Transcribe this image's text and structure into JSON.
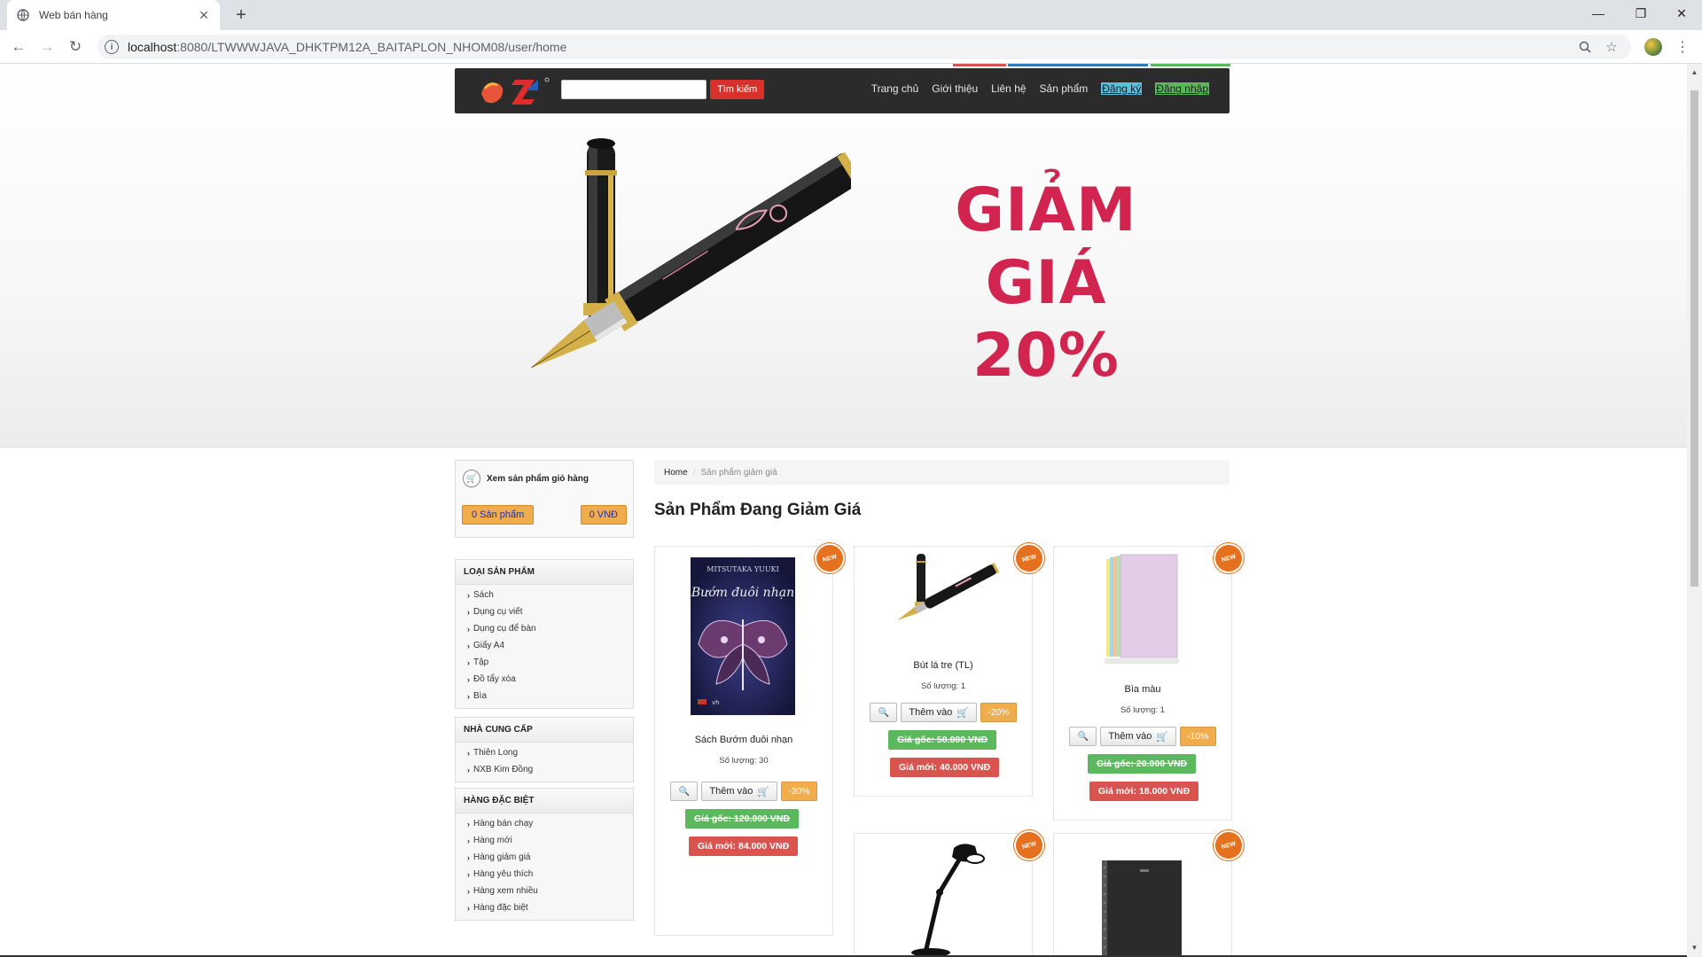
{
  "browser": {
    "tab_title": "Web bán hàng",
    "url_host": "localhost",
    "url_path": ":8080/LTWWWJAVA_DHKTPM12A_BAITAPLON_NHOM08/user/home"
  },
  "nav": {
    "search_button": "Tìm kiếm",
    "links": [
      "Trang chủ",
      "Giới thiệu",
      "Liên hệ",
      "Sản phẩm",
      "Đăng ký",
      "Đăng nhập"
    ]
  },
  "banner": {
    "line1": "GIẢM",
    "line2": "GIÁ",
    "line3": "20%"
  },
  "cart": {
    "title": "Xem sản phẩm giỏ hàng",
    "count": "0 Sản phẩm",
    "total": "0 VNĐ"
  },
  "sidebar": {
    "categories_title": "LOẠI SẢN PHẨM",
    "categories": [
      "Sách",
      "Dụng cụ viết",
      "Dụng cụ để bàn",
      "Giấy A4",
      "Tập",
      "Đồ tẩy xóa",
      "Bìa"
    ],
    "suppliers_title": "NHÀ CUNG CẤP",
    "suppliers": [
      "Thiên Long",
      "NXB Kim Đồng"
    ],
    "special_title": "HÀNG ĐẶC BIỆT",
    "special": [
      "Hàng bán chạy",
      "Hàng mới",
      "Hàng giảm giá",
      "Hàng yêu thích",
      "Hàng xem nhiều",
      "Hàng đặc biệt"
    ]
  },
  "main": {
    "breadcrumb_home": "Home",
    "breadcrumb_current": "Sản phẩm giảm giá",
    "title": "Sản Phẩm Đang Giảm Giá",
    "badge": "NEW",
    "add_label": "Thêm vào",
    "products": [
      {
        "name": "Sách Bướm đuôi nhạn",
        "qty": "Số lượng: 30",
        "discount": "-30%",
        "old_price": "Giá gốc: 120.000 VNĐ",
        "new_price": "Giá mới: 84.000 VNĐ",
        "cover_author": "MITSUTAKA YUUKI",
        "cover_title": "Bướm đuôi nhạn"
      },
      {
        "name": "Bút lá tre (TL)",
        "qty": "Số lượng: 1",
        "discount": "-20%",
        "old_price": "Giá gốc: 50.000 VNĐ",
        "new_price": "Giá mới: 40.000 VNĐ"
      },
      {
        "name": "Bìa màu",
        "qty": "Số lượng: 1",
        "discount": "-10%",
        "old_price": "Giá gốc: 20.000 VNĐ",
        "new_price": "Giá mới: 18.000 VNĐ"
      }
    ]
  }
}
